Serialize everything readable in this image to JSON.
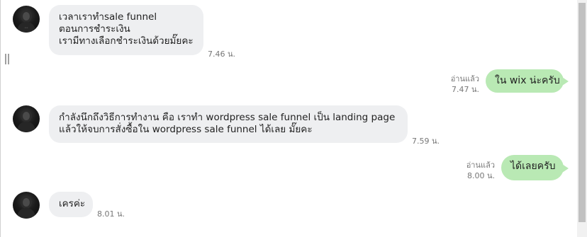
{
  "messages": [
    {
      "direction": "incoming",
      "lines": [
        "เวลาเราทำsale funnel",
        "ตอนการชำระเงิน",
        "เรามีทางเลือกชำระเงินด้วยมั๊ยคะ"
      ],
      "time": "7.46 น."
    },
    {
      "direction": "outgoing",
      "text": "ใน wix น่ะครับ",
      "read_label": "อ่านแล้ว",
      "time": "7.47 น."
    },
    {
      "direction": "incoming",
      "lines": [
        "กำลังนึกถึงวิธีการทำงาน คือ เราทำ wordpress sale funnel เป็น landing page",
        "แล้วให้จบการสั่งซื้อใน wordpress sale funnel ได้เลย มั๊ยคะ"
      ],
      "time": "7.59 น."
    },
    {
      "direction": "outgoing",
      "text": "ได้เลยครับ",
      "read_label": "อ่านแล้ว",
      "time": "8.00 น."
    },
    {
      "direction": "incoming",
      "lines": [
        "เครค่ะ"
      ],
      "time": "8.01 น."
    }
  ],
  "icons": {
    "avatar": "user-avatar-photo",
    "resize": "drag-handle-icon"
  },
  "colors": {
    "incoming_bubble": "#eeeff1",
    "outgoing_bubble": "#b9e9b4",
    "timestamp": "#777777"
  }
}
